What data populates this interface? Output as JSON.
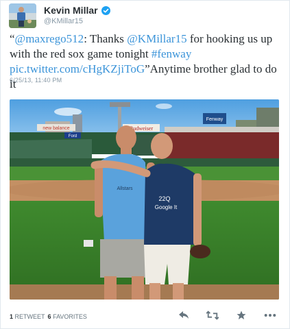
{
  "tweet": {
    "name": "Kevin Millar",
    "handle": "@KMillar15",
    "text_parts": [
      {
        "text": "“",
        "link": false
      },
      {
        "text": "@maxrego512",
        "link": true
      },
      {
        "text": ": Thanks ",
        "link": false
      },
      {
        "text": "@KMillar15",
        "link": true
      },
      {
        "text": " for hooking us up with the red sox game tonight ",
        "link": false
      },
      {
        "text": "#fenway",
        "link": true
      },
      {
        "text": " ",
        "link": false
      },
      {
        "text": "pic.twitter.com/cHgKZjiToG",
        "link": true
      },
      {
        "text": "”Anytime brother glad to do it",
        "link": false
      }
    ],
    "timestamp": "6/25/13, 11:40 PM"
  },
  "photo": {
    "signs": {
      "new_balance": "new balance",
      "ford": "Ford",
      "budweiser": "Budweiser",
      "fenway": "Fenway"
    },
    "shirt_left": "Allstars",
    "shirt_right_top": "22Q",
    "shirt_right_bottom": "Google It"
  },
  "stats": {
    "retweets_count": "1",
    "retweets_label": "RETWEET",
    "favorites_count": "6",
    "favorites_label": "FAVORITES"
  },
  "icons": [
    "verified-icon",
    "reply-icon",
    "retweet-icon",
    "favorite-icon",
    "more-icon"
  ],
  "colors": {
    "link": "#3b94d9",
    "verified": "#1da1f2",
    "muted": "#8899a6"
  }
}
